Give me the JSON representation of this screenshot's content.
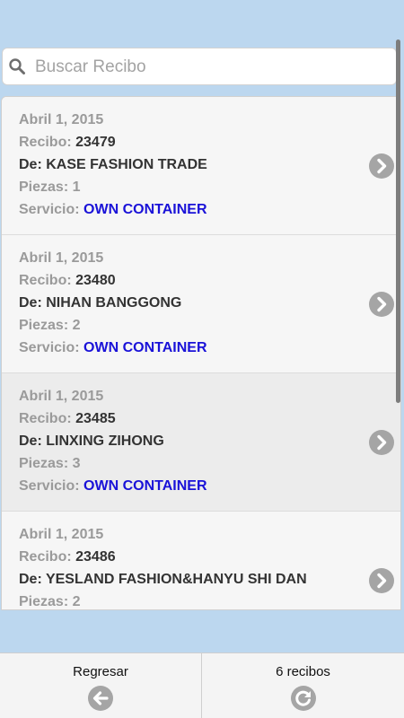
{
  "search": {
    "placeholder": "Buscar Recibo",
    "value": ""
  },
  "receipts": [
    {
      "date": "Abril 1, 2015",
      "recibo_label": "Recibo:",
      "recibo": "23479",
      "from": "De: KASE FASHION TRADE",
      "piezas": "Piezas: 1",
      "servicio_label": "Servicio:",
      "servicio": "OWN CONTAINER"
    },
    {
      "date": "Abril 1, 2015",
      "recibo_label": "Recibo:",
      "recibo": "23480",
      "from": "De: NIHAN BANGGONG",
      "piezas": "Piezas: 2",
      "servicio_label": "Servicio:",
      "servicio": "OWN CONTAINER"
    },
    {
      "date": "Abril 1, 2015",
      "recibo_label": "Recibo:",
      "recibo": "23485",
      "from": "De: LINXING ZIHONG",
      "piezas": "Piezas: 3",
      "servicio_label": "Servicio:",
      "servicio": "OWN CONTAINER"
    },
    {
      "date": "Abril 1, 2015",
      "recibo_label": "Recibo:",
      "recibo": "23486",
      "from": "De: YESLAND FASHION&HANYU SHI DAN",
      "piezas": "Piezas: 2",
      "servicio_label": "",
      "servicio": ""
    }
  ],
  "footer": {
    "back_label": "Regresar",
    "back_icon": "arrow-left-icon",
    "count_label": "6 recibos",
    "refresh_icon": "refresh-icon"
  },
  "colors": {
    "background": "#bcd7ef",
    "service_blue": "#1a12d8",
    "icon_gray": "#a5a5a5"
  }
}
